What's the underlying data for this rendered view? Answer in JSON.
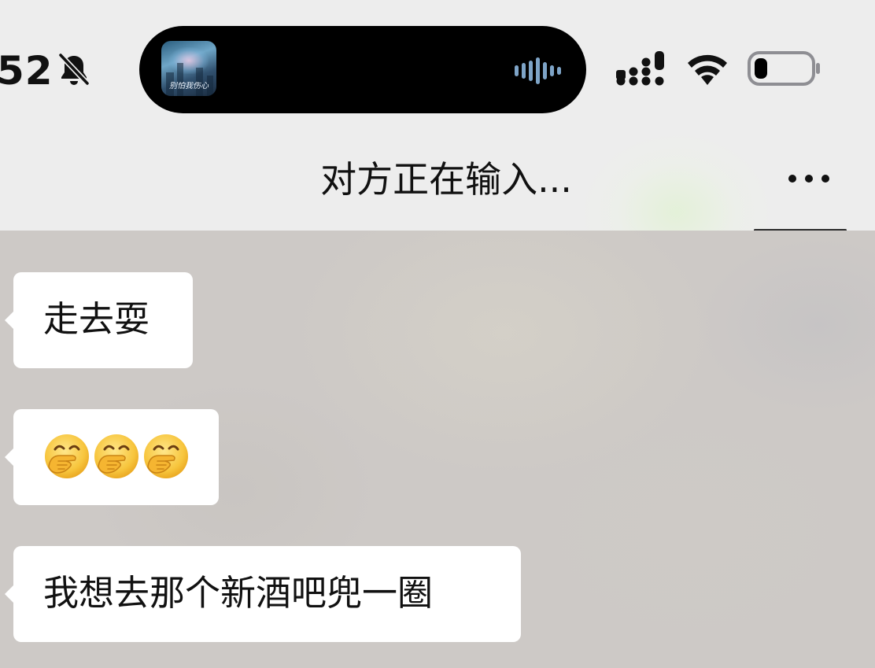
{
  "status_bar": {
    "time": "52",
    "mute_icon": "bell-slash-icon",
    "now_playing_art_text": "别怕我伤心",
    "signal_icon": "cellular-signal-icon",
    "wifi_icon": "wifi-icon",
    "battery_icon": "battery-low-icon"
  },
  "nav": {
    "title": "对方正在输入...",
    "more_icon": "more-icon"
  },
  "messages": [
    {
      "text": "走去耍"
    },
    {
      "emoji": [
        "face-with-hand-over-mouth",
        "face-with-hand-over-mouth",
        "face-with-hand-over-mouth"
      ]
    },
    {
      "text": "我想去那个新酒吧兜一圈"
    }
  ],
  "colors": {
    "status_bg": "#ededed",
    "chat_bg": "#cdc9c6",
    "bubble": "#ffffff",
    "text": "#111111",
    "island": "#000000",
    "battery_outline": "#8e8e93"
  }
}
